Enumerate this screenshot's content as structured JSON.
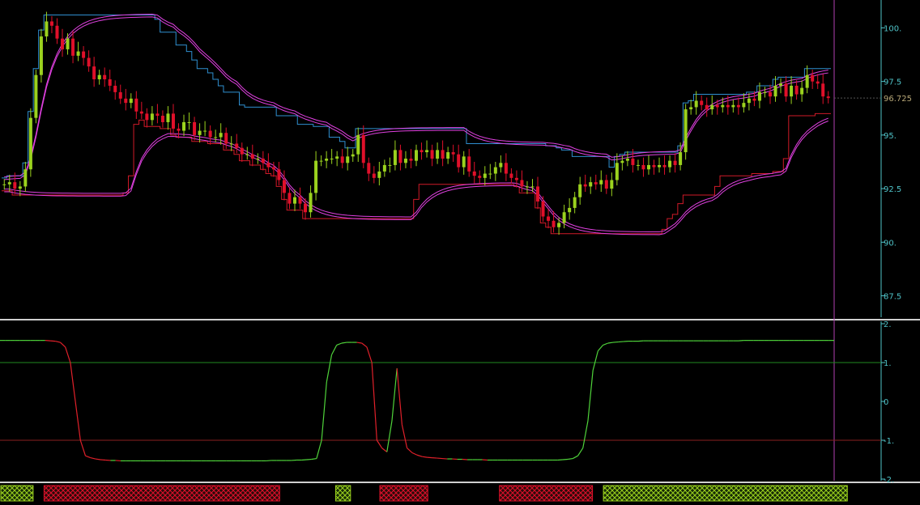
{
  "chart_data": [
    {
      "type": "candlestick",
      "title": "",
      "xlabel": "",
      "ylabel": "",
      "ylim": [
        86.5,
        101.3
      ],
      "y_ticks": [
        "100.",
        "97.5",
        "95.",
        "92.5",
        "90.",
        "87.5"
      ],
      "y_tick_values": [
        100,
        97.5,
        95,
        92.5,
        90,
        87.5
      ],
      "last_price": {
        "label": "96.725",
        "value": 96.725
      },
      "grid": false,
      "colors": {
        "up": "#9bd21e",
        "down": "#e0102a",
        "upper_band": "#2f8fd0",
        "lower_band": "#d01a28",
        "envelope": "#e040e0",
        "axis": "#4fc3c8"
      },
      "closes": [
        92.7,
        92.8,
        92.5,
        92.6,
        93.4,
        95.8,
        97.8,
        99.6,
        100.3,
        100.1,
        99.5,
        99.0,
        99.5,
        98.7,
        98.9,
        98.6,
        98.2,
        97.6,
        97.8,
        97.6,
        97.3,
        97.0,
        96.7,
        96.5,
        96.7,
        96.1,
        96.0,
        95.7,
        96.0,
        95.9,
        95.6,
        96.0,
        95.3,
        95.2,
        95.6,
        95.6,
        95.0,
        95.2,
        95.2,
        94.9,
        94.9,
        95.1,
        94.6,
        94.6,
        94.4,
        94.1,
        94.1,
        93.9,
        93.9,
        93.7,
        93.5,
        93.4,
        92.9,
        92.3,
        91.8,
        92.1,
        91.8,
        91.4,
        92.3,
        93.8,
        93.8,
        93.9,
        93.9,
        94.0,
        93.7,
        94.0,
        94.1,
        95.0,
        93.7,
        93.2,
        93.0,
        93.3,
        93.6,
        93.6,
        94.3,
        93.7,
        93.9,
        93.8,
        94.3,
        94.2,
        94.3,
        93.9,
        94.3,
        93.9,
        94.2,
        94.1,
        93.5,
        94.0,
        93.3,
        93.1,
        93.0,
        93.2,
        93.2,
        93.5,
        93.7,
        93.2,
        93.0,
        92.9,
        92.6,
        92.6,
        92.6,
        91.9,
        91.2,
        91.0,
        90.7,
        90.9,
        91.4,
        91.6,
        92.1,
        92.7,
        92.6,
        92.8,
        92.7,
        92.9,
        92.5,
        92.9,
        93.7,
        93.8,
        93.9,
        93.6,
        93.6,
        93.4,
        93.6,
        93.5,
        93.6,
        93.5,
        93.8,
        93.6,
        94.2,
        96.2,
        96.3,
        96.6,
        96.4,
        96.2,
        96.4,
        96.3,
        96.4,
        96.3,
        96.4,
        96.3,
        96.5,
        96.7,
        96.6,
        97.0,
        97.0,
        96.8,
        97.3,
        97.4,
        96.8,
        97.3,
        96.9,
        97.2,
        97.8,
        97.5,
        97.4,
        96.8,
        96.725
      ],
      "indicator": {
        "ylim": [
          -2,
          2
        ],
        "y_ticks": [
          "2.",
          "1.",
          "0",
          "-1.",
          "-2."
        ],
        "y_tick_values": [
          2,
          1,
          0,
          -1,
          -2
        ],
        "levels": [
          1,
          -1
        ],
        "values": [
          1.57,
          1.57,
          1.57,
          1.57,
          1.57,
          1.57,
          1.57,
          1.57,
          1.57,
          1.57,
          1.56,
          1.55,
          1.52,
          1.4,
          1.0,
          0.0,
          -1.0,
          -1.4,
          -1.45,
          -1.48,
          -1.5,
          -1.51,
          -1.52,
          -1.52,
          -1.53,
          -1.53,
          -1.53,
          -1.53,
          -1.53,
          -1.53,
          -1.53,
          -1.53,
          -1.53,
          -1.53,
          -1.53,
          -1.53,
          -1.53,
          -1.53,
          -1.53,
          -1.53,
          -1.53,
          -1.53,
          -1.53,
          -1.53,
          -1.53,
          -1.53,
          -1.53,
          -1.53,
          -1.53,
          -1.53,
          -1.53,
          -1.53,
          -1.53,
          -1.53,
          -1.52,
          -1.52,
          -1.52,
          -1.52,
          -1.52,
          -1.51,
          -1.51,
          -1.5,
          -1.49,
          -1.47,
          -1.0,
          0.5,
          1.2,
          1.45,
          1.5,
          1.52,
          1.52,
          1.52,
          1.5,
          1.4,
          1.0,
          -1.0,
          -1.2,
          -1.3,
          -0.5,
          0.85,
          -0.6,
          -1.2,
          -1.32,
          -1.38,
          -1.42,
          -1.44,
          -1.45,
          -1.46,
          -1.47,
          -1.48,
          -1.48,
          -1.49,
          -1.49,
          -1.5,
          -1.5,
          -1.5,
          -1.5,
          -1.51,
          -1.51,
          -1.51,
          -1.51,
          -1.51,
          -1.51,
          -1.51,
          -1.51,
          -1.51,
          -1.51,
          -1.51,
          -1.51,
          -1.51,
          -1.51,
          -1.51,
          -1.5,
          -1.49,
          -1.47,
          -1.4,
          -1.2,
          -0.5,
          0.8,
          1.3,
          1.45,
          1.5,
          1.52,
          1.53,
          1.54,
          1.55,
          1.55,
          1.55,
          1.56,
          1.56,
          1.56,
          1.56,
          1.56,
          1.56,
          1.56,
          1.56,
          1.56,
          1.56,
          1.56,
          1.56,
          1.56,
          1.56,
          1.56,
          1.56,
          1.56,
          1.56,
          1.56,
          1.56,
          1.57,
          1.57,
          1.57,
          1.57,
          1.57,
          1.57,
          1.57,
          1.57,
          1.57,
          1.57,
          1.57,
          1.57,
          1.57,
          1.57,
          1.57,
          1.57,
          1.57,
          1.57,
          1.57
        ]
      },
      "signal_bars": [
        {
          "state": "up",
          "from": 0.0,
          "to": 0.036
        },
        {
          "state": "down",
          "from": 0.047,
          "to": 0.304
        },
        {
          "state": "up",
          "from": 0.364,
          "to": 0.381
        },
        {
          "state": "down",
          "from": 0.412,
          "to": 0.465
        },
        {
          "state": "down",
          "from": 0.542,
          "to": 0.644
        },
        {
          "state": "up",
          "from": 0.655,
          "to": 0.921
        }
      ]
    }
  ]
}
